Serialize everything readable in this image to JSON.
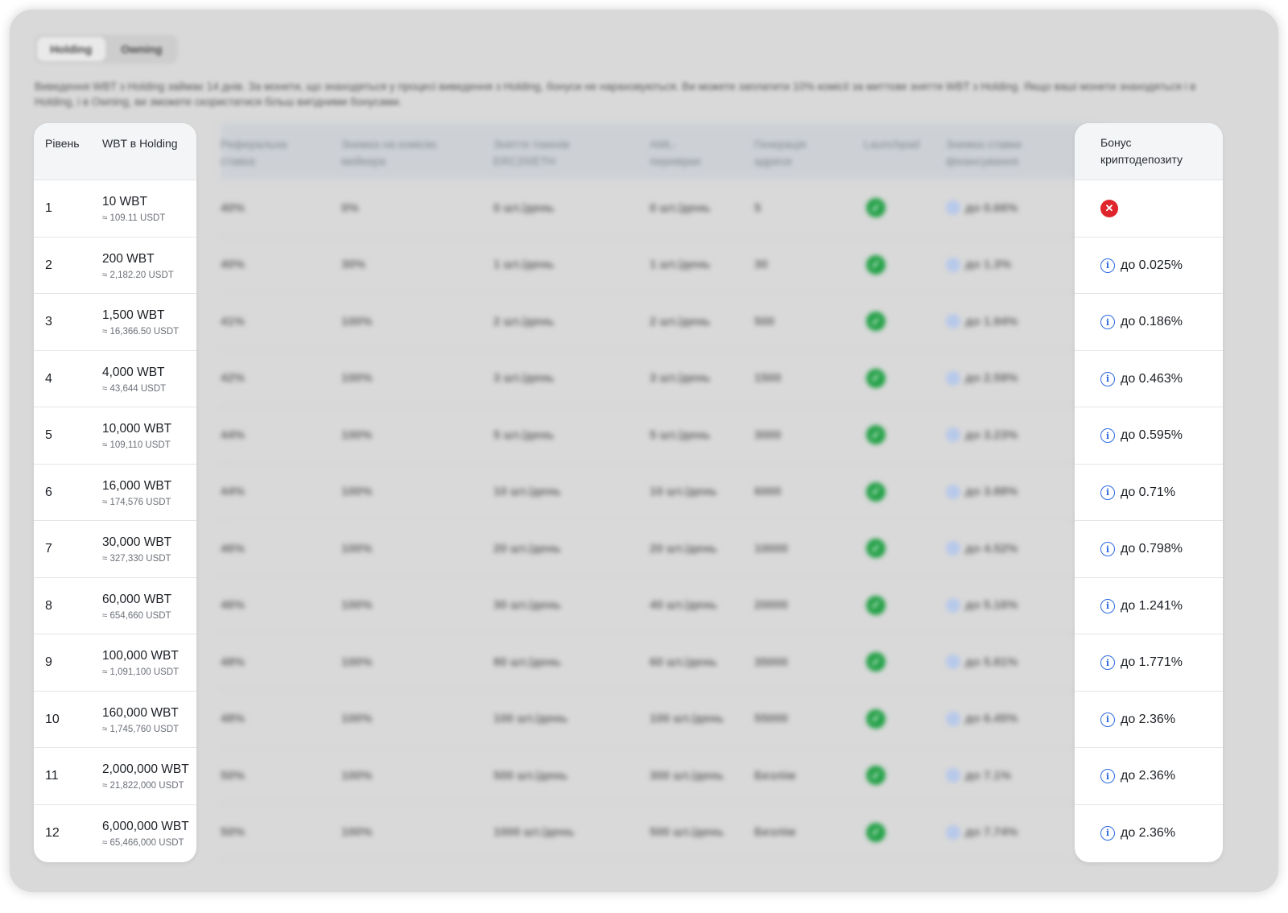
{
  "tabs": [
    {
      "label": "Holding",
      "active": true
    },
    {
      "label": "Owning",
      "active": false
    }
  ],
  "notice": "Виведення WBT з Holding займає 14 днів. За монети, що знаходяться у процесі виведення з Holding, бонуси не нараховуються. Ви можете заплатити 10% комісії за миттєве зняття WBT з Holding. Якщо ваші монети знаходяться і в Holding, і в Owning, ви зможете скористатися більш вигідними бонусами.",
  "headers": {
    "level": "Рівень",
    "wbt": "WBT в Holding",
    "referral": "Реферальна ставка",
    "maker_fee": "Знижка на комісію мейкера",
    "withdrawal": "Зняття токенів ERC20/ETH",
    "aml": "AML-перевірки",
    "addresses": "Генерація адреси",
    "launchpad": "Launchpad",
    "funding": "Знижка ставки фінансування",
    "bonus": "Бонус криптодепозиту"
  },
  "rows": [
    {
      "level": "1",
      "wbt": "10 WBT",
      "usdt": "≈ 109.11 USDT",
      "referral": "40%",
      "maker": "0%",
      "withdraw": "0 шт./день",
      "aml": "0 шт./день",
      "addr": "5",
      "funding": "до 0.66%",
      "bonus": "",
      "bonus_icon": "x-icon"
    },
    {
      "level": "2",
      "wbt": "200 WBT",
      "usdt": "≈ 2,182.20 USDT",
      "referral": "40%",
      "maker": "30%",
      "withdraw": "1 шт./день",
      "aml": "1 шт./день",
      "addr": "30",
      "funding": "до 1.3%",
      "bonus": "до 0.025%",
      "bonus_icon": "info-icon"
    },
    {
      "level": "3",
      "wbt": "1,500 WBT",
      "usdt": "≈ 16,366.50 USDT",
      "referral": "41%",
      "maker": "100%",
      "withdraw": "2 шт./день",
      "aml": "2 шт./день",
      "addr": "500",
      "funding": "до 1.94%",
      "bonus": "до 0.186%",
      "bonus_icon": "info-icon"
    },
    {
      "level": "4",
      "wbt": "4,000 WBT",
      "usdt": "≈ 43,644 USDT",
      "referral": "42%",
      "maker": "100%",
      "withdraw": "3 шт./день",
      "aml": "3 шт./день",
      "addr": "1500",
      "funding": "до 2.59%",
      "bonus": "до 0.463%",
      "bonus_icon": "info-icon"
    },
    {
      "level": "5",
      "wbt": "10,000 WBT",
      "usdt": "≈ 109,110 USDT",
      "referral": "44%",
      "maker": "100%",
      "withdraw": "5 шт./день",
      "aml": "5 шт./день",
      "addr": "3000",
      "funding": "до 3.23%",
      "bonus": "до 0.595%",
      "bonus_icon": "info-icon"
    },
    {
      "level": "6",
      "wbt": "16,000 WBT",
      "usdt": "≈ 174,576 USDT",
      "referral": "44%",
      "maker": "100%",
      "withdraw": "10 шт./день",
      "aml": "10 шт./день",
      "addr": "6000",
      "funding": "до 3.88%",
      "bonus": "до 0.71%",
      "bonus_icon": "info-icon"
    },
    {
      "level": "7",
      "wbt": "30,000 WBT",
      "usdt": "≈ 327,330 USDT",
      "referral": "46%",
      "maker": "100%",
      "withdraw": "20 шт./день",
      "aml": "20 шт./день",
      "addr": "10000",
      "funding": "до 4.52%",
      "bonus": "до 0.798%",
      "bonus_icon": "info-icon"
    },
    {
      "level": "8",
      "wbt": "60,000 WBT",
      "usdt": "≈ 654,660 USDT",
      "referral": "46%",
      "maker": "100%",
      "withdraw": "30 шт./день",
      "aml": "40 шт./день",
      "addr": "20000",
      "funding": "до 5.16%",
      "bonus": "до 1.241%",
      "bonus_icon": "info-icon"
    },
    {
      "level": "9",
      "wbt": "100,000 WBT",
      "usdt": "≈ 1,091,100 USDT",
      "referral": "48%",
      "maker": "100%",
      "withdraw": "80 шт./день",
      "aml": "60 шт./день",
      "addr": "35000",
      "funding": "до 5.81%",
      "bonus": "до 1.771%",
      "bonus_icon": "info-icon"
    },
    {
      "level": "10",
      "wbt": "160,000 WBT",
      "usdt": "≈ 1,745,760 USDT",
      "referral": "48%",
      "maker": "100%",
      "withdraw": "100 шт./день",
      "aml": "100 шт./день",
      "addr": "55000",
      "funding": "до 6.45%",
      "bonus": "до 2.36%",
      "bonus_icon": "info-icon"
    },
    {
      "level": "11",
      "wbt": "2,000,000 WBT",
      "usdt": "≈ 21,822,000 USDT",
      "referral": "50%",
      "maker": "100%",
      "withdraw": "500 шт./день",
      "aml": "300 шт./день",
      "addr": "Безлім",
      "funding": "до 7.1%",
      "bonus": "до 2.36%",
      "bonus_icon": "info-icon"
    },
    {
      "level": "12",
      "wbt": "6,000,000 WBT",
      "usdt": "≈ 65,466,000 USDT",
      "referral": "50%",
      "maker": "100%",
      "withdraw": "1000 шт./день",
      "aml": "500 шт./день",
      "addr": "Безлім",
      "funding": "до 7.74%",
      "bonus": "до 2.36%",
      "bonus_icon": "info-icon"
    }
  ],
  "colors": {
    "success": "#24a148",
    "error": "#e0242c",
    "info": "#2d6ae0"
  }
}
